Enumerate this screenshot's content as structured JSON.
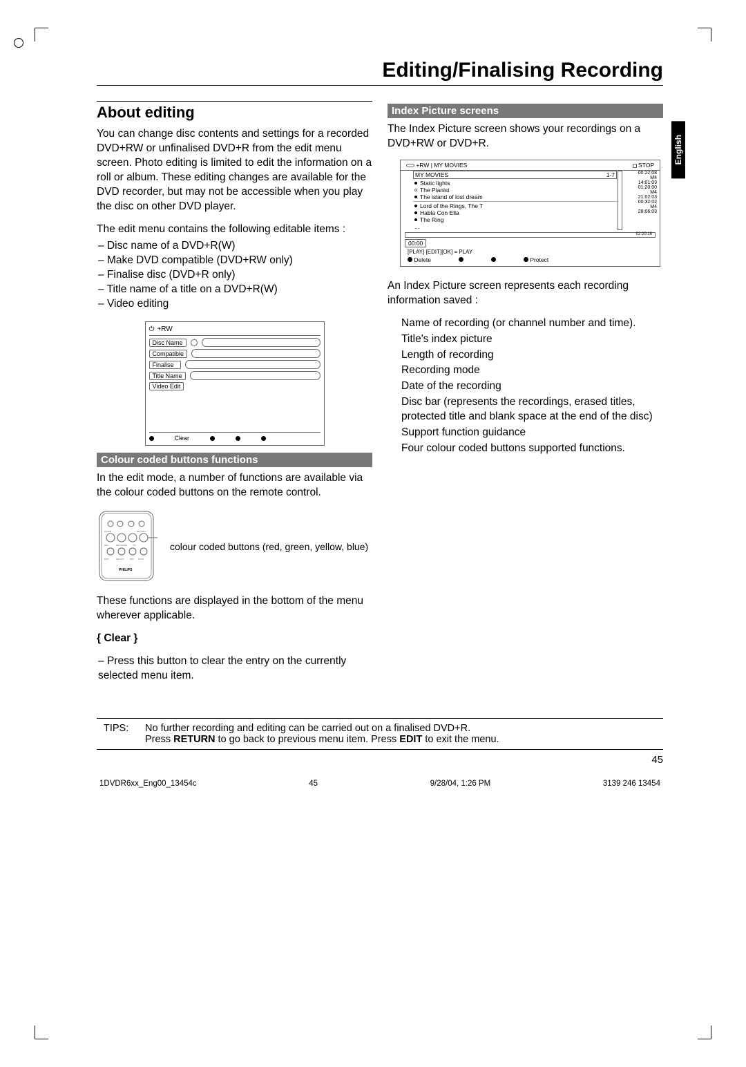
{
  "title": "Editing/Finalising Recording",
  "language_tab": "English",
  "page_number": "45",
  "left": {
    "heading": "About editing",
    "p1": "You can change disc contents and settings for a recorded DVD+RW or unfinalised DVD+R from the edit menu screen. Photo editing is limited to edit the information on a roll or album.  These editing changes are available for the DVD recorder, but may not be accessible when you play the disc on other DVD player.",
    "p2": "The edit menu contains the following editable items :",
    "items": [
      "Disc name of a DVD+R(W)",
      "Make DVD compatible (DVD+RW only)",
      "Finalise disc (DVD+R only)",
      "Title name of a title on a DVD+R(W)",
      "Video editing"
    ],
    "edit_menu": {
      "hdr": "+RW",
      "rows": [
        "Disc Name",
        "Compatible",
        "Finalise",
        "Title Name",
        "Video Edit"
      ],
      "clear": "Clear"
    },
    "sub1": "Colour coded buttons functions",
    "p3": "In the edit mode, a number of functions are available via the colour coded buttons on the remote control.",
    "remote_caption": "colour coded buttons (red, green, yellow, blue)",
    "p4": "These functions are displayed in the bottom of the menu wherever applicable.",
    "clear_heading": "{ Clear }",
    "clear_text": "Press this button to clear the entry on the currently selected menu item."
  },
  "right": {
    "sub": "Index Picture screens",
    "p1": "The Index Picture screen shows your recordings on a DVD+RW or DVD+R.",
    "index": {
      "top_left": "+RW | MY MOVIES",
      "top_right_label": "STOP",
      "list_header_left": "MY MOVIES",
      "list_header_right": "1-7",
      "items": [
        {
          "name": "Static lights",
          "time": "00:22:08"
        },
        {
          "name": "The Pianist",
          "mode": "M4",
          "time": "14:01:03"
        },
        {
          "name": "The island of lost dream",
          "time": "01:20:00"
        },
        {
          "name": "Lord of the Rings, The T",
          "mode": "M4",
          "time": "21:02:03"
        },
        {
          "name": "Habla Con Ella",
          "time": "00:32:02"
        },
        {
          "name": "The Ring",
          "mode": "M4",
          "time": "28:06:03"
        },
        {
          "name": "...",
          "time": ""
        }
      ],
      "disc_time": "02:20:16",
      "timecode": "00:00",
      "guide": "[PLAY] [EDIT][OK] = PLAY",
      "btn_delete": "Delete",
      "btn_protect": "Protect"
    },
    "p2": "An Index Picture screen represents each recording information saved :",
    "fields": [
      "Name of recording (or channel number and time).",
      "Title's index picture",
      "Length of recording",
      "Recording mode",
      "Date of the recording",
      "Disc bar (represents the recordings, erased titles, protected title and blank space at the end of the disc)",
      "Support function guidance",
      "Four colour coded buttons supported functions."
    ]
  },
  "tips": {
    "label": "TIPS:",
    "line1": "No further recording and editing can be carried out on a finalised DVD+R.",
    "line2a": "Press ",
    "line2b": "RETURN",
    "line2c": " to go back to previous menu item.  Press ",
    "line2d": "EDIT",
    "line2e": " to exit the menu."
  },
  "footer": {
    "file": "1DVDR6xx_Eng00_13454c",
    "pg": "45",
    "date": "9/28/04, 1:26 PM",
    "code": "3139 246 13454"
  }
}
